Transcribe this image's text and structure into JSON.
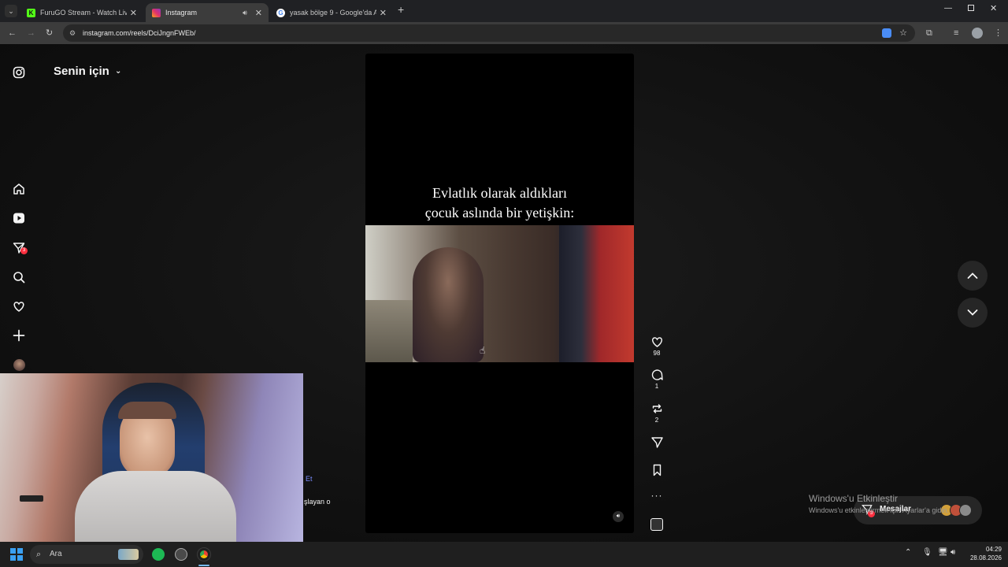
{
  "browser": {
    "tabs": [
      {
        "title": "FuruGO Stream - Watch Live on",
        "favicon": "K",
        "favicon_color": "#53fc18"
      },
      {
        "title": "Instagram",
        "favicon": "instagram-logo",
        "favicon_color": "#e1306c"
      },
      {
        "title": "yasak bölge 9 - Google'da Ara",
        "favicon": "G",
        "favicon_color": "#ffffff"
      }
    ],
    "url": "instagram.com/reels/DciJngnFWEb/"
  },
  "instagram": {
    "feed_selector": "Senin için",
    "sidebar": {
      "notification_badge": "3",
      "items": [
        "instagram-logo",
        "home",
        "reels",
        "messages",
        "search",
        "notifications",
        "create",
        "profile"
      ]
    },
    "reel": {
      "caption_line1": "Evlatlık olarak aldıkları",
      "caption_line2": "çocuk aslında bir yetişkin:"
    },
    "actions": {
      "likes": "98",
      "comments": "1",
      "reposts": "2"
    },
    "partial_text": {
      "follow_fragment": "Et",
      "desc_fragment": "şlayan o"
    },
    "messages_label": "Mesajlar",
    "messages_badge": "3",
    "accent": "#ff3040"
  },
  "windows": {
    "watermark_title": "Windows'u Etkinleştir",
    "watermark_sub": "Windows'u etkinleştirmek için Ayarlar'a gidin.",
    "search_placeholder": "Ara",
    "time": "04:29",
    "date": "28.08.2026"
  }
}
